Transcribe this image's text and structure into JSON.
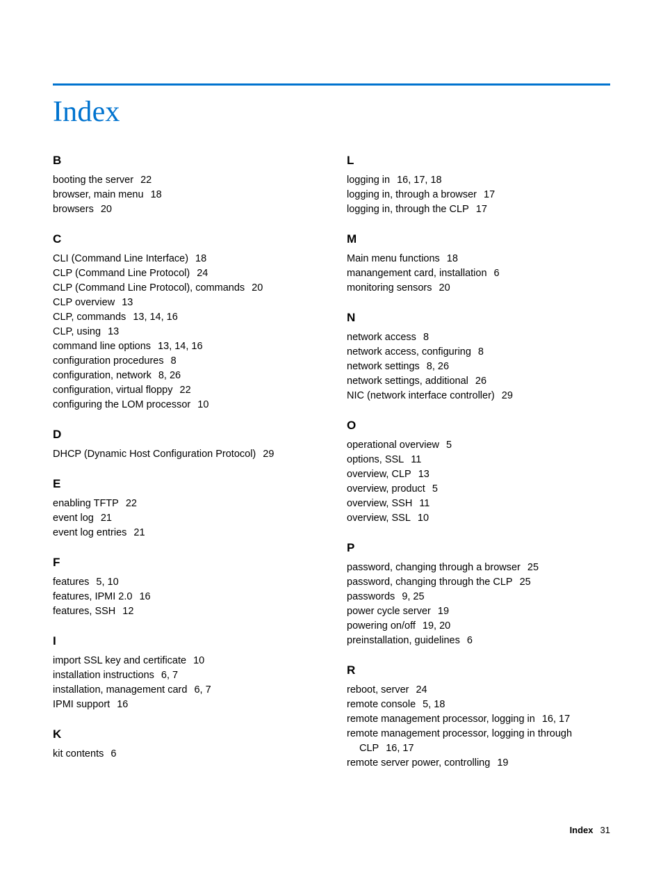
{
  "title": "Index",
  "left_sections": [
    {
      "letter": "B",
      "entries": [
        {
          "label": "booting the server",
          "pages": "22"
        },
        {
          "label": "browser, main menu",
          "pages": "18"
        },
        {
          "label": "browsers",
          "pages": "20"
        }
      ]
    },
    {
      "letter": "C",
      "entries": [
        {
          "label": "CLI (Command Line Interface)",
          "pages": "18"
        },
        {
          "label": "CLP (Command Line Protocol)",
          "pages": "24"
        },
        {
          "label": "CLP (Command Line Protocol), commands",
          "pages": "20"
        },
        {
          "label": "CLP overview",
          "pages": "13"
        },
        {
          "label": "CLP, commands",
          "pages": "13, 14, 16"
        },
        {
          "label": "CLP, using",
          "pages": "13"
        },
        {
          "label": "command line options",
          "pages": "13, 14, 16"
        },
        {
          "label": "configuration procedures",
          "pages": "8"
        },
        {
          "label": "configuration, network",
          "pages": "8, 26"
        },
        {
          "label": "configuration, virtual floppy",
          "pages": "22"
        },
        {
          "label": "configuring the LOM processor",
          "pages": "10"
        }
      ]
    },
    {
      "letter": "D",
      "entries": [
        {
          "label": "DHCP (Dynamic Host Configuration Protocol)",
          "pages": "29"
        }
      ]
    },
    {
      "letter": "E",
      "entries": [
        {
          "label": "enabling TFTP",
          "pages": "22"
        },
        {
          "label": "event log",
          "pages": "21"
        },
        {
          "label": "event log entries",
          "pages": "21"
        }
      ]
    },
    {
      "letter": "F",
      "entries": [
        {
          "label": "features",
          "pages": "5, 10"
        },
        {
          "label": "features, IPMI 2.0",
          "pages": "16"
        },
        {
          "label": "features, SSH",
          "pages": "12"
        }
      ]
    },
    {
      "letter": "I",
      "entries": [
        {
          "label": "import SSL key and certificate",
          "pages": "10"
        },
        {
          "label": "installation instructions",
          "pages": "6, 7"
        },
        {
          "label": "installation, management card",
          "pages": "6, 7"
        },
        {
          "label": "IPMI support",
          "pages": "16"
        }
      ]
    },
    {
      "letter": "K",
      "entries": [
        {
          "label": "kit contents",
          "pages": "6"
        }
      ]
    }
  ],
  "right_sections": [
    {
      "letter": "L",
      "entries": [
        {
          "label": "logging in",
          "pages": "16, 17, 18"
        },
        {
          "label": "logging in, through a browser",
          "pages": "17"
        },
        {
          "label": "logging in, through the CLP",
          "pages": "17"
        }
      ]
    },
    {
      "letter": "M",
      "entries": [
        {
          "label": "Main menu functions",
          "pages": "18"
        },
        {
          "label": "manangement card, installation",
          "pages": "6"
        },
        {
          "label": "monitoring sensors",
          "pages": "20"
        }
      ]
    },
    {
      "letter": "N",
      "entries": [
        {
          "label": "network access",
          "pages": "8"
        },
        {
          "label": "network access, configuring",
          "pages": "8"
        },
        {
          "label": "network settings",
          "pages": "8, 26"
        },
        {
          "label": "network settings, additional",
          "pages": "26"
        },
        {
          "label": "NIC (network interface controller)",
          "pages": "29"
        }
      ]
    },
    {
      "letter": "O",
      "entries": [
        {
          "label": "operational overview",
          "pages": "5"
        },
        {
          "label": "options, SSL",
          "pages": "11"
        },
        {
          "label": "overview, CLP",
          "pages": "13"
        },
        {
          "label": "overview, product",
          "pages": "5"
        },
        {
          "label": "overview, SSH",
          "pages": "11"
        },
        {
          "label": "overview, SSL",
          "pages": "10"
        }
      ]
    },
    {
      "letter": "P",
      "entries": [
        {
          "label": "password, changing through a browser",
          "pages": "25"
        },
        {
          "label": "password, changing through the CLP",
          "pages": "25"
        },
        {
          "label": "passwords",
          "pages": "9, 25"
        },
        {
          "label": "power cycle server",
          "pages": "19"
        },
        {
          "label": "powering on/off",
          "pages": "19, 20"
        },
        {
          "label": "preinstallation, guidelines",
          "pages": "6"
        }
      ]
    },
    {
      "letter": "R",
      "entries": [
        {
          "label": "reboot, server",
          "pages": "24"
        },
        {
          "label": "remote console",
          "pages": "5, 18"
        },
        {
          "label": "remote management processor, logging in",
          "pages": "16, 17"
        },
        {
          "label": "remote management processor, logging in through CLP",
          "pages": "16, 17"
        },
        {
          "label": "remote server power, controlling",
          "pages": "19"
        }
      ]
    }
  ],
  "footer": {
    "label": "Index",
    "page": "31"
  }
}
